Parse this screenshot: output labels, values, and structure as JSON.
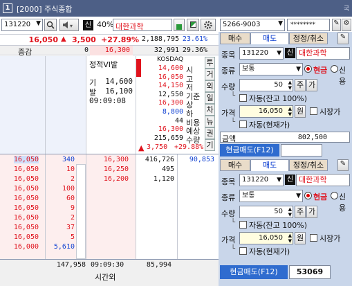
{
  "window": {
    "number": "1",
    "title": "[2000] 주식종합",
    "corner": "국"
  },
  "toolbar": {
    "code": "131220",
    "sin": "신",
    "margin": "40%",
    "name": "대한과학"
  },
  "price": {
    "current": "16,050",
    "change_arrow": "▲",
    "change": "3,500",
    "change_pct": "+27.89%",
    "volume": "2,188,795",
    "ratio": "23.61%"
  },
  "summary": {
    "label": "증감",
    "val": "0",
    "price": "16,300",
    "vol": "32,991",
    "pct": "29.36%"
  },
  "info": {
    "vi": "정적VI발",
    "gi_label": "기",
    "gi_val": "14,600",
    "bal_label": "발",
    "bal_val": "16,100",
    "time": "09:09:08"
  },
  "market": "KOSDAQ",
  "stats": [
    {
      "v": "14,600",
      "l": "시",
      "c": "red"
    },
    {
      "v": "16,050",
      "l": "고",
      "c": "red"
    },
    {
      "v": "14,150",
      "l": "저",
      "c": "red"
    },
    {
      "v": "12,550",
      "l": "기준",
      "c": "dark"
    },
    {
      "v": "16,300",
      "l": "상",
      "c": "red"
    },
    {
      "v": "8,800",
      "l": "하",
      "c": "blue"
    },
    {
      "v": "44",
      "l": "비용",
      "c": "dark"
    },
    {
      "v": "16,300",
      "l": "예상",
      "c": "red"
    },
    {
      "v": "215,659",
      "l": "수량",
      "c": "dark"
    }
  ],
  "expected": {
    "arrow": "▲",
    "chg": "3,750",
    "pct": "+29.88%"
  },
  "vtabs": [
    "투",
    "거",
    "외",
    "일",
    "차",
    "뉴",
    "권",
    "기"
  ],
  "asks": [
    {
      "price": "16,300",
      "qty": "416,726"
    },
    {
      "price": "16,250",
      "qty": "495"
    },
    {
      "price": "16,200",
      "qty": "1,120"
    }
  ],
  "ask_total": "90,853",
  "trades": [
    {
      "p": "16,050",
      "q": "340"
    },
    {
      "p": "16,050",
      "q": "10"
    },
    {
      "p": "16,050",
      "q": "2"
    },
    {
      "p": "16,050",
      "q": "100"
    },
    {
      "p": "16,050",
      "q": "60"
    },
    {
      "p": "16,050",
      "q": "9"
    },
    {
      "p": "16,050",
      "q": "2"
    },
    {
      "p": "16,050",
      "q": "37"
    },
    {
      "p": "16,050",
      "q": "5"
    },
    {
      "p": "16,000",
      "q": "5,610"
    }
  ],
  "footer": {
    "total": "147,958",
    "time": "09:09:30",
    "time_label": "시간외",
    "qty": "85,994"
  },
  "account": {
    "number": "5266-9003",
    "password": "********"
  },
  "order_top": {
    "tabs": [
      "매수",
      "매도",
      "정정/취소"
    ],
    "code_label": "종목",
    "code": "131220",
    "sin": "신",
    "name": "대한과학",
    "type_label": "종류",
    "type": "보통",
    "cash": "현금",
    "credit": "신용",
    "qty_label": "수량",
    "qty": "50",
    "ju": "주",
    "ga": "가",
    "auto1": "자동(잔고 100%)",
    "price_label": "가격",
    "price": "16,050",
    "won": "원",
    "market": "시장가",
    "auto2": "자동(현재가)",
    "amount_label": "금액",
    "amount": "802,500",
    "submit": "현금매도(F12)"
  },
  "order_bottom": {
    "tabs": [
      "매수",
      "매도",
      "정정/취소"
    ],
    "code_label": "종목",
    "code": "131220",
    "sin": "신",
    "name": "대한과학",
    "type_label": "종류",
    "type": "보통",
    "cash": "현금",
    "credit": "신용",
    "qty_label": "수량",
    "qty": "50",
    "ju": "주",
    "ga": "가",
    "auto1": "자동(잔고 100%)",
    "price_label": "가격",
    "price": "16,050",
    "won": "원",
    "market": "시장가",
    "auto2": "자동(현재가)",
    "submit": "현금매도(F12)",
    "order_no": "53069"
  }
}
